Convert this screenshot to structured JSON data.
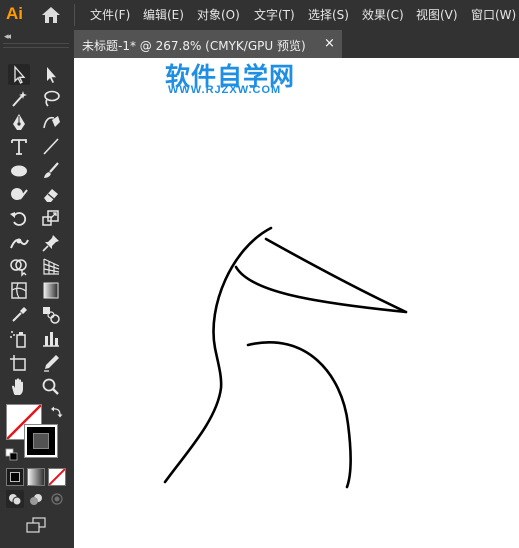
{
  "app": {
    "logo_text": "Ai"
  },
  "menu": {
    "items": [
      "文件(F)",
      "编辑(E)",
      "对象(O)",
      "文字(T)",
      "选择(S)",
      "效果(C)",
      "视图(V)",
      "窗口(W)"
    ]
  },
  "tab": {
    "title": "未标题-1* @ 267.8% (CMYK/GPU 预览)",
    "close": "×"
  },
  "toolbar": {
    "collapse": "◂◂"
  },
  "watermark": {
    "title": "软件自学网",
    "url": "WWW.RJZXW.COM"
  },
  "colors": {
    "menubar_bg": "#323232",
    "workspace_bg": "#535353",
    "canvas_bg": "#ffffff",
    "logo": "#ff9a00",
    "watermark": "#1e8fe3",
    "stroke": "#000000",
    "none_swatch": "#e8141b"
  }
}
